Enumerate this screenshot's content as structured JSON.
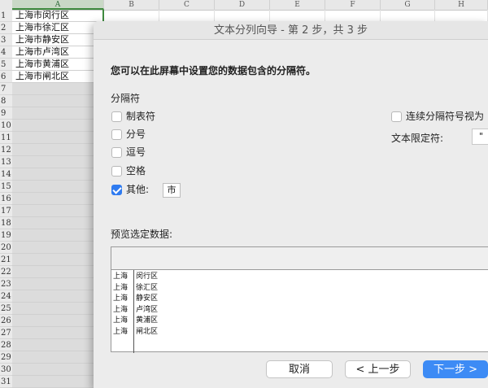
{
  "spreadsheet": {
    "columns": [
      "A",
      "B",
      "C",
      "D",
      "E",
      "F",
      "G",
      "H"
    ],
    "rows": [
      "1",
      "2",
      "3",
      "4",
      "5",
      "6",
      "7",
      "8",
      "9",
      "10",
      "11",
      "12",
      "13",
      "14",
      "15",
      "16",
      "17",
      "18",
      "19",
      "20",
      "21",
      "22",
      "23",
      "24",
      "25",
      "26",
      "27",
      "28",
      "29",
      "30",
      "31"
    ],
    "col_a_values": [
      "上海市闵行区",
      "上海市徐汇区",
      "上海市静安区",
      "上海市卢湾区",
      "上海市黄浦区",
      "上海市闸北区"
    ]
  },
  "dialog": {
    "title": "文本分列向导 - 第 2 步，共 3 步",
    "instruction": "您可以在此屏幕中设置您的数据包含的分隔符。",
    "delimiters_label": "分隔符",
    "delimiters": [
      {
        "label": "制表符",
        "checked": false
      },
      {
        "label": "分号",
        "checked": false
      },
      {
        "label": "逗号",
        "checked": false
      },
      {
        "label": "空格",
        "checked": false
      },
      {
        "label": "其他:",
        "checked": true
      }
    ],
    "other_value": "市",
    "consecutive_label": "连续分隔符号视为",
    "text_qualifier_label": "文本限定符:",
    "text_qualifier_value": "\"",
    "preview_label": "预览选定数据:",
    "preview_col1": [
      "上海",
      "上海",
      "上海",
      "上海",
      "上海",
      "上海"
    ],
    "preview_col2": [
      "闵行区",
      "徐汇区",
      "静安区",
      "卢湾区",
      "黄浦区",
      "闸北区"
    ],
    "buttons": {
      "cancel": "取消",
      "back": "< 上一步",
      "next": "下一步 >"
    }
  }
}
